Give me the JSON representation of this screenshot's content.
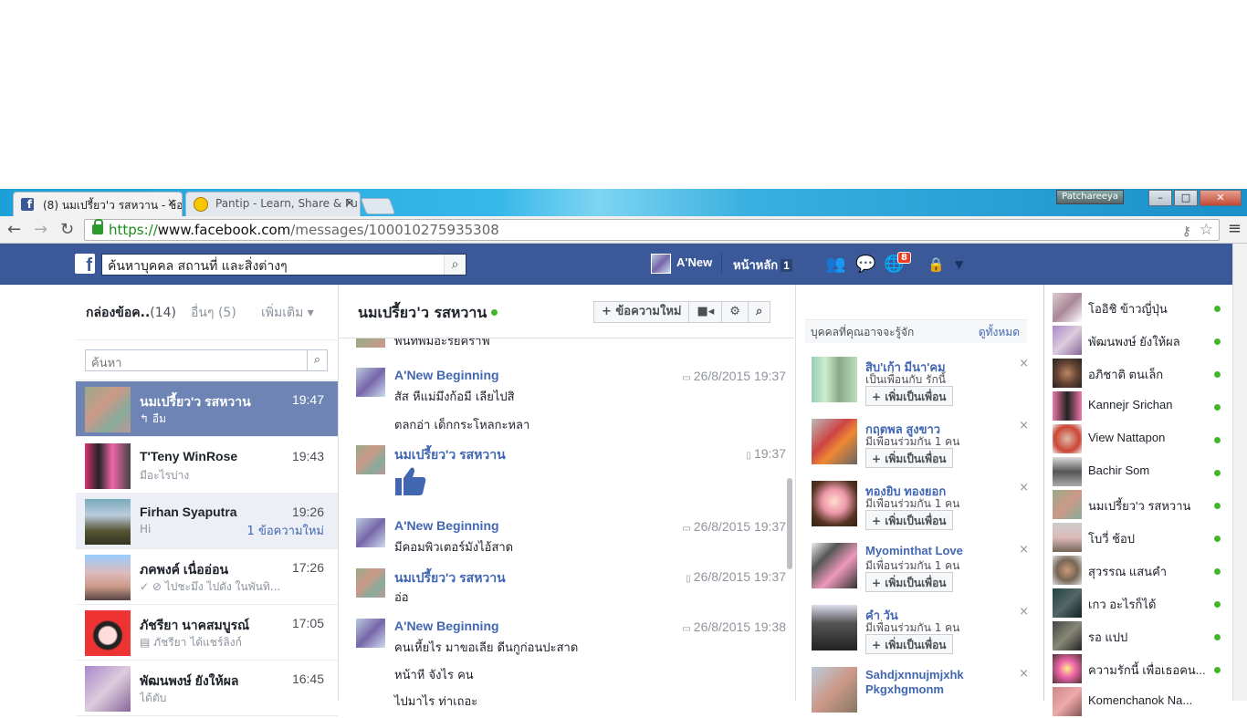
{
  "browser": {
    "tabs": [
      {
        "label": "(8) นมเปรี้ยว'ว รสหวาน - ข้อค",
        "close": "×"
      },
      {
        "label": "Pantip - Learn, Share & Fu",
        "close": "×"
      }
    ],
    "profile": "Patchareeya",
    "window_buttons": {
      "min": "–",
      "max": "□",
      "close": "✕"
    },
    "url": {
      "scheme": "https://",
      "domain": "www.facebook.com",
      "path": "/messages/100010275935308"
    },
    "nav": {
      "back": "←",
      "forward": "→",
      "reload": "↻",
      "star": "☆",
      "key": "⚷",
      "menu": "≡"
    }
  },
  "fb_header": {
    "logo": "f",
    "search_placeholder": "ค้นหาบุคคล สถานที่ และสิ่งต่างๆ",
    "user_name": "A'New",
    "home_label": "หน้าหลัก",
    "home_count": "1",
    "notif_count": "8",
    "icons": [
      "friends-icon",
      "messages-icon",
      "globe-icon",
      "privacy-icon",
      "dropdown-icon"
    ]
  },
  "inbox": {
    "title": "กล่องข้อค..",
    "title_count": "(14)",
    "other_label": "อื่นๆ (5)",
    "more_label": "เพิ่มเติม ▾",
    "search_placeholder": "ค้นหา",
    "threads": [
      {
        "name": "นมเปรี้ยว'ว รสหวาน",
        "time": "19:47",
        "snippet": "↰ อืม",
        "unread": ""
      },
      {
        "name": "T'Teny WinRose",
        "time": "19:43",
        "snippet": "มีอะไรบ่าง",
        "unread": ""
      },
      {
        "name": "Firhan Syaputra",
        "time": "19:26",
        "snippet": "Hi",
        "unread": "1 ข้อความใหม่"
      },
      {
        "name": "ภคพงค์ เนื่ออ่อน",
        "time": "17:26",
        "snippet": "✓ ⊘ ไปชะมึง ไปดัง ในพันทิ...",
        "unread": ""
      },
      {
        "name": "ภัชรียา นาคสมบูรณ์",
        "time": "17:05",
        "snippet": "▤ ภัชรียา ได้แชร์ลิงก์",
        "unread": ""
      },
      {
        "name": "พัฒนพงษ์ ยังให้ผล",
        "time": "16:45",
        "snippet": "ได้ตับ",
        "unread": ""
      }
    ]
  },
  "conversation": {
    "title": "นมเปรี้ยว'ว รสหวาน",
    "new_message": "+ ข้อความใหม่",
    "video_icon": "■◂",
    "gear_icon": "⚙",
    "search_icon": "⌕",
    "top_cut_text": "พันทิพมือะรัยคราฟ",
    "messages": [
      {
        "sender": "A'New Beginning",
        "time": "26/8/2015 19:37",
        "lines": [
          "สัส หีแม่มึงก้อมี เลียไปสิ",
          "ตลกอ่า เด็กกระโหลกะหลา"
        ]
      },
      {
        "sender": "นมเปรี้ยว'ว รสหวาน",
        "time": "19:37",
        "lines": []
      },
      {
        "sender": "A'New Beginning",
        "time": "26/8/2015 19:37",
        "lines": [
          "มีคอมพิวเตอร์มังไอ้สาด"
        ]
      },
      {
        "sender": "นมเปรี้ยว'ว รสหวาน",
        "time": "26/8/2015 19:37",
        "lines": [
          "อ่อ"
        ]
      },
      {
        "sender": "A'New Beginning",
        "time": "26/8/2015 19:38",
        "lines": [
          "คนเหี้ยไร มาขอเลีย ดีนกูก่อนปะสาด",
          "หน้าหี จังไร คน",
          "ไปมาไร ท่าเถอะ"
        ]
      }
    ]
  },
  "suggestions": {
    "title": "บุคคลที่คุณอาจจะรู้จัก",
    "see_all": "ดูทั้งหมด",
    "add_label": "+ เพิ่มเป็นเพื่อน",
    "close": "×",
    "people": [
      {
        "name": "สิบ'เก้า มีนา'คม",
        "sub": "เป็นเพื่อนกับ รักนี้"
      },
      {
        "name": "กฤตพล สูงขาว",
        "sub": "มีเพื่อนร่วมกัน 1 คน"
      },
      {
        "name": "ทองยิบ ทองยอก",
        "sub": "มีเพื่อนร่วมกัน 1 คน"
      },
      {
        "name": "Myominthat Love",
        "sub": "มีเพื่อนร่วมกัน 1 คน"
      },
      {
        "name": "คำ วัน",
        "sub": "มีเพื่อนร่วมกัน 1 คน"
      },
      {
        "name": "Sahdjxnnujmjxhk Pkgxhgmonm",
        "sub": ""
      }
    ]
  },
  "chat": {
    "contacts": [
      "โออิชิ ข้าวญี่ปุ่น",
      "พัฒนพงษ์ ยังให้ผล",
      "อภิชาติ ตนเล็ก",
      "Kannejr Srichan",
      "View Nattapon",
      "Bachir Som",
      "นมเปรี้ยว'ว รสหวาน",
      "โบวี่ ช้อป",
      "สุวรรณ แสนคำ",
      "เกว อะไรก็ได้",
      "รอ แปป",
      "ความรักนี้ เพื่อเธอคน...",
      "Komenchanok Na..."
    ]
  },
  "colors": {
    "fb_blue": "#3b5998",
    "link_blue": "#4267b2",
    "online_green": "#42b72a",
    "selected_thread": "#6d84b4"
  }
}
